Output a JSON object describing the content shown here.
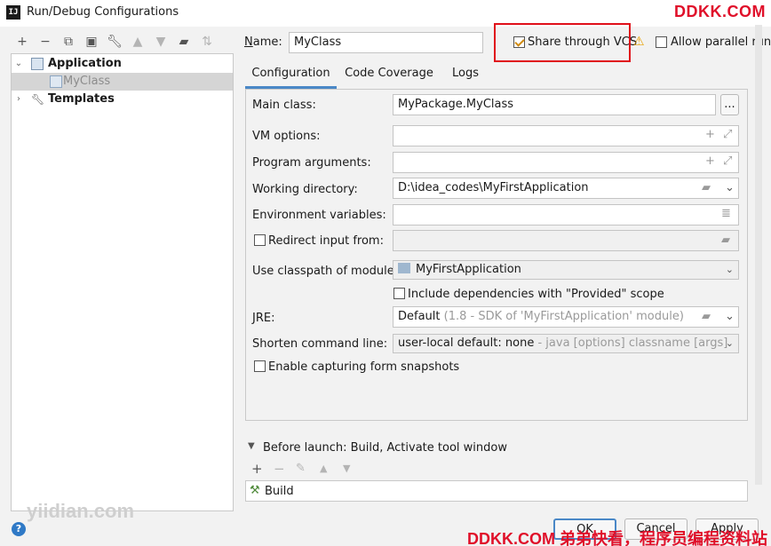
{
  "window": {
    "title": "Run/Debug Configurations"
  },
  "watermarks": {
    "top_right": "DDKK.COM",
    "bottom_left": "yiidian.com",
    "bottom_right": "DDKK.COM 弟弟快看，程序员编程资料站"
  },
  "toolbar": {
    "icons": [
      "plus-icon",
      "minus-icon",
      "copy-icon",
      "save-icon",
      "wrench-icon",
      "up-icon",
      "down-icon",
      "folder-icon",
      "sort-icon"
    ]
  },
  "tree": {
    "application_label": "Application",
    "myclass_label": "MyClass",
    "templates_label": "Templates"
  },
  "name_row": {
    "name_label": "Name:",
    "name_value": "MyClass",
    "share_label": "Share through VCS",
    "share_checked": true,
    "parallel_label": "Allow parallel run",
    "parallel_checked": false
  },
  "tabs": [
    "Configuration",
    "Code Coverage",
    "Logs"
  ],
  "form": {
    "main_class_label": "Main class:",
    "main_class_value": "MyPackage.MyClass",
    "browse_label": "...",
    "vm_options_label": "VM options:",
    "vm_options_value": "",
    "program_args_label": "Program arguments:",
    "program_args_value": "",
    "working_dir_label": "Working directory:",
    "working_dir_value": "D:\\idea_codes\\MyFirstApplication",
    "env_vars_label": "Environment variables:",
    "env_vars_value": "",
    "redirect_label": "Redirect input from:",
    "redirect_checked": false,
    "classpath_label": "Use classpath of module:",
    "classpath_value": "MyFirstApplication",
    "include_deps_label": "Include dependencies with \"Provided\" scope",
    "include_deps_checked": false,
    "jre_label": "JRE:",
    "jre_value_main": "Default",
    "jre_value_hint": "(1.8 - SDK of 'MyFirstApplication' module)",
    "shorten_label": "Shorten command line:",
    "shorten_value_main": "user-local default: none",
    "shorten_value_hint": "- java [options] classname [args]",
    "snapshots_label": "Enable capturing form snapshots",
    "snapshots_checked": false
  },
  "before_launch": {
    "label": "Before launch: Build, Activate tool window",
    "item": "Build"
  },
  "buttons": {
    "ok": "OK",
    "cancel": "Cancel",
    "apply": "Apply"
  },
  "help_label": "?",
  "colors": {
    "accent": "#4a88c7",
    "highlight": "#e0101a",
    "warning": "#e8a000",
    "watermark": "#e0102a"
  }
}
